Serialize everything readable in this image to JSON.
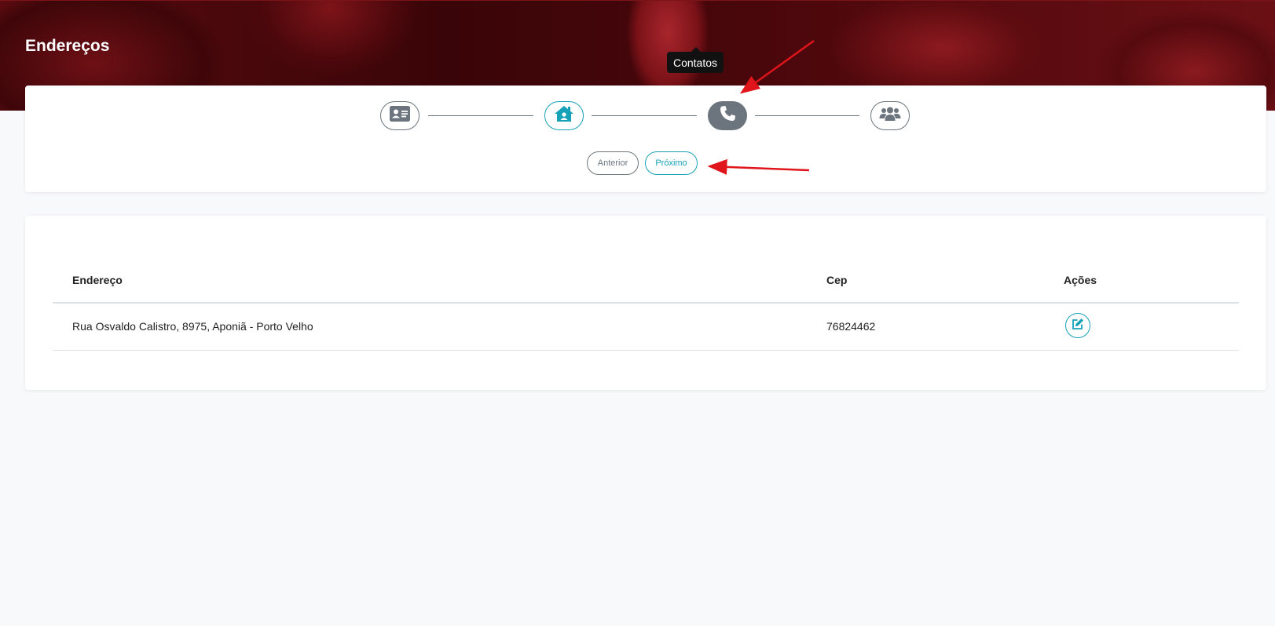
{
  "header": {
    "title": "Endereços"
  },
  "steps": [
    {
      "icon": "id-card-icon",
      "state": "default"
    },
    {
      "icon": "home-icon",
      "state": "done"
    },
    {
      "icon": "phone-icon",
      "state": "active"
    },
    {
      "icon": "users-icon",
      "state": "default"
    }
  ],
  "tooltip": {
    "text": "Contatos"
  },
  "buttons": {
    "previous": "Anterior",
    "next": "Próximo"
  },
  "table": {
    "columns": [
      "Endereço",
      "Cep",
      "Ações"
    ],
    "rows": [
      {
        "address": "Rua Osvaldo Calistro, 8975, Aponiã - Porto Velho",
        "cep": "76824462",
        "action_icon": "edit-icon"
      }
    ]
  },
  "colors": {
    "accent": "#17a2b8",
    "secondary": "#6c757d",
    "annotation_arrow": "#e0151b",
    "hero": "#5a0b0f"
  }
}
